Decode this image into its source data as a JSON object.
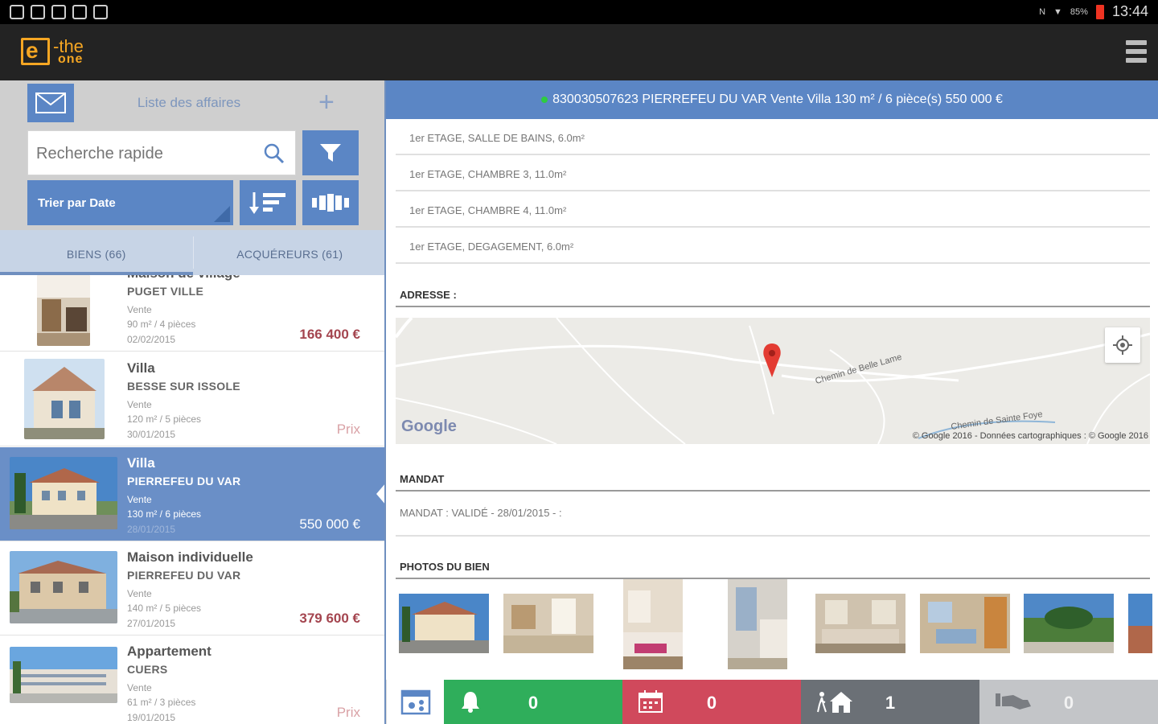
{
  "status_bar": {
    "time": "13:44",
    "battery": "85%"
  },
  "app": {
    "logo_e": "e",
    "logo_the": "-the",
    "logo_one": "one"
  },
  "left_panel": {
    "title": "Liste des affaires",
    "search_placeholder": "Recherche rapide",
    "sort_label": "Trier par Date",
    "tabs": [
      {
        "label": "BIENS (66)",
        "active": true
      },
      {
        "label": "ACQUÉREURS (61)",
        "active": false
      }
    ],
    "items": [
      {
        "title": "Maison de village",
        "city": "PUGET VILLE",
        "type": "Vente",
        "surface": "90 m² / 4 pièces",
        "date": "02/02/2015",
        "price": "166 400 €",
        "price_style": "bold",
        "selected": false
      },
      {
        "title": "Villa",
        "city": "BESSE SUR ISSOLE",
        "type": "Vente",
        "surface": "120 m² / 5 pièces",
        "date": "30/01/2015",
        "price": "Prix",
        "price_style": "light",
        "selected": false
      },
      {
        "title": "Villa",
        "city": "PIERREFEU DU VAR",
        "type": "Vente",
        "surface": "130 m² / 6 pièces",
        "date": "28/01/2015",
        "price": "550 000 €",
        "price_style": "bold",
        "selected": true
      },
      {
        "title": "Maison individuelle",
        "city": "PIERREFEU DU VAR",
        "type": "Vente",
        "surface": "140 m² / 5 pièces",
        "date": "27/01/2015",
        "price": "379 600 €",
        "price_style": "bold",
        "selected": false
      },
      {
        "title": "Appartement",
        "city": "CUERS",
        "type": "Vente",
        "surface": "61 m² / 3 pièces",
        "date": "19/01/2015",
        "price": "Prix",
        "price_style": "light",
        "selected": false
      }
    ]
  },
  "detail": {
    "header": "830030507623 PIERREFEU DU VAR Vente Villa 130 m² / 6 pièce(s) 550 000 €",
    "rooms": [
      "1er ETAGE, SALLE DE BAINS, 6.0m²",
      "1er ETAGE, CHAMBRE 3, 11.0m²",
      "1er ETAGE, CHAMBRE 4, 11.0m²",
      "1er ETAGE, DEGAGEMENT, 6.0m²"
    ],
    "address_title": "ADRESSE :",
    "map": {
      "road_1": "Chemin de Belle Lame",
      "road_2": "Chemin de Sainte Foye",
      "google": "Google",
      "copyright": "© Google 2016 - Données cartographiques : © Google 2016"
    },
    "mandat_title": "MANDAT",
    "mandat_text": "MANDAT : VALIDÉ - 28/01/2015 - :",
    "photos_title": "PHOTOS DU BIEN"
  },
  "bottom_bar": {
    "alerts": "0",
    "calendar": "0",
    "visits": "1",
    "offers": "0"
  },
  "colors": {
    "accent_blue": "#5b86c5",
    "green": "#2fae5b",
    "red": "#d0495c",
    "grey": "#6b7076",
    "light_grey": "#c3c5c8",
    "price_red": "#a4454f",
    "logo_orange": "#f5a623"
  }
}
